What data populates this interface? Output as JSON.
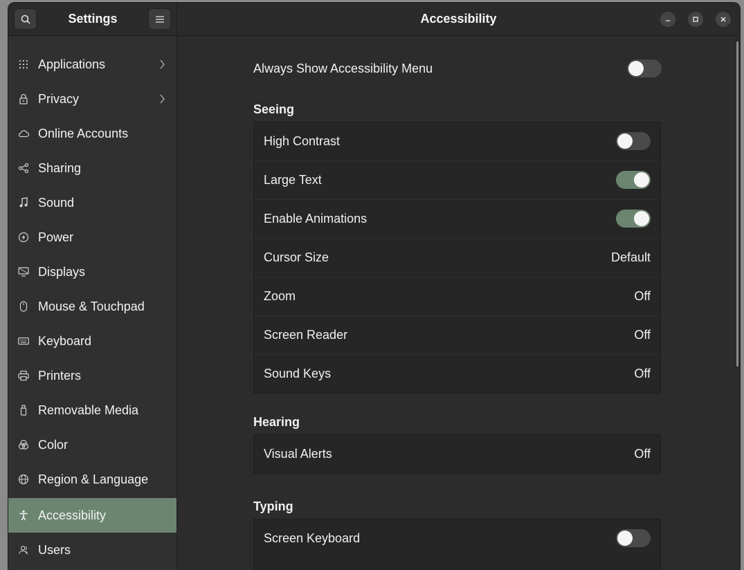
{
  "header": {
    "app_title": "Settings",
    "page_title": "Accessibility"
  },
  "sidebar": {
    "items": [
      {
        "label": "Applications",
        "icon": "grid-icon",
        "chevron": true
      },
      {
        "label": "Privacy",
        "icon": "lock-icon",
        "chevron": true
      },
      {
        "label": "Online Accounts",
        "icon": "cloud-icon",
        "chevron": false
      },
      {
        "label": "Sharing",
        "icon": "share-icon",
        "chevron": false
      },
      {
        "label": "Sound",
        "icon": "music-note-icon",
        "chevron": false
      },
      {
        "label": "Power",
        "icon": "power-icon",
        "chevron": false
      },
      {
        "label": "Displays",
        "icon": "display-icon",
        "chevron": false
      },
      {
        "label": "Mouse & Touchpad",
        "icon": "mouse-icon",
        "chevron": false
      },
      {
        "label": "Keyboard",
        "icon": "keyboard-icon",
        "chevron": false
      },
      {
        "label": "Printers",
        "icon": "printer-icon",
        "chevron": false
      },
      {
        "label": "Removable Media",
        "icon": "usb-drive-icon",
        "chevron": false
      },
      {
        "label": "Color",
        "icon": "color-icon",
        "chevron": false
      },
      {
        "label": "Region & Language",
        "icon": "globe-icon",
        "chevron": false
      },
      {
        "label": "Accessibility",
        "icon": "accessibility-icon",
        "chevron": false,
        "active": true
      },
      {
        "label": "Users",
        "icon": "users-icon",
        "chevron": false
      }
    ]
  },
  "main": {
    "always_show_menu": {
      "label": "Always Show Accessibility Menu",
      "on": false
    },
    "seeing": {
      "title": "Seeing",
      "rows": [
        {
          "label": "High Contrast",
          "type": "switch",
          "on": false
        },
        {
          "label": "Large Text",
          "type": "switch",
          "on": true
        },
        {
          "label": "Enable Animations",
          "type": "switch",
          "on": true
        },
        {
          "label": "Cursor Size",
          "type": "value",
          "value": "Default"
        },
        {
          "label": "Zoom",
          "type": "value",
          "value": "Off"
        },
        {
          "label": "Screen Reader",
          "type": "value",
          "value": "Off"
        },
        {
          "label": "Sound Keys",
          "type": "value",
          "value": "Off"
        }
      ]
    },
    "hearing": {
      "title": "Hearing",
      "rows": [
        {
          "label": "Visual Alerts",
          "type": "value",
          "value": "Off"
        }
      ]
    },
    "typing": {
      "title": "Typing",
      "rows": [
        {
          "label": "Screen Keyboard",
          "type": "switch",
          "on": false
        }
      ]
    }
  },
  "colors": {
    "accent": "#6b8571",
    "window_bg": "#2f2f2f",
    "group_bg": "#262626"
  }
}
